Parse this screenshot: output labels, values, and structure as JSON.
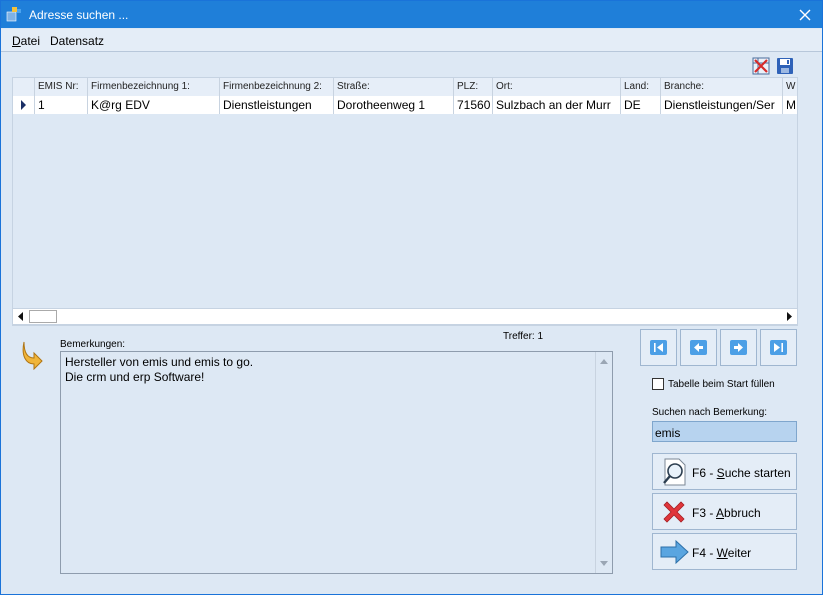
{
  "window": {
    "title": "Adresse suchen ...",
    "accent": "#1f7fd9"
  },
  "menu": {
    "items": [
      {
        "label": "Datei",
        "hotkey": "D",
        "rest": "atei"
      },
      {
        "label": "Datensatz"
      }
    ]
  },
  "toolbar": {
    "icons": [
      "delete-column-icon",
      "save-icon"
    ]
  },
  "grid": {
    "columns": [
      "EMIS Nr:",
      "Firmenbezeichnung 1:",
      "Firmenbezeichnung 2:",
      "Straße:",
      "PLZ:",
      "Ort:",
      "Land:",
      "Branche:",
      "W"
    ],
    "rows": [
      [
        "1",
        "K@rg EDV",
        "Dienstleistungen",
        "Dorotheenweg 1",
        "71560",
        "Sulzbach an der Murr",
        "DE",
        "Dienstleistungen/Ser",
        "M"
      ]
    ]
  },
  "status": {
    "hits": "Treffer: 1"
  },
  "remarks": {
    "label": "Bemerkungen:",
    "lines": [
      "Hersteller von emis und emis to go.",
      "Die crm und erp Software!"
    ]
  },
  "navigation": [
    "first-record-icon",
    "previous-record-icon",
    "next-record-icon",
    "last-record-icon"
  ],
  "options": {
    "fill_table_label": "Tabelle beim Start füllen",
    "fill_table_checked": false
  },
  "search": {
    "label": "Suchen nach Bemerkung:",
    "value": "emis"
  },
  "actions": {
    "search": {
      "prefix": "F6 - ",
      "hotkey": "S",
      "rest": "uche starten"
    },
    "cancel": {
      "prefix": "F3 - ",
      "hotkey": "A",
      "rest": "bbruch"
    },
    "next": {
      "prefix": "F4 - ",
      "hotkey": "W",
      "rest": "eiter"
    }
  }
}
